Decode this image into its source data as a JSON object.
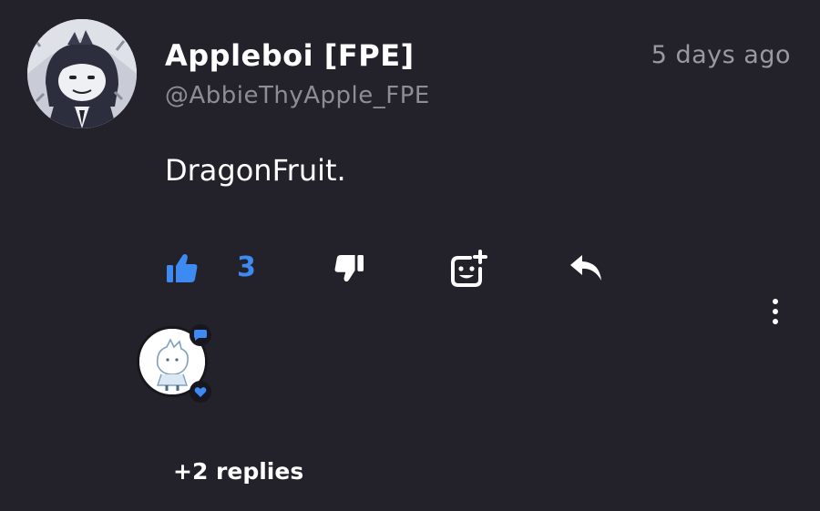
{
  "comment": {
    "author_name": "Appleboi [FPE]",
    "author_handle": "@AbbieThyApple_FPE",
    "timestamp": "5 days ago",
    "text": "DragonFruit."
  },
  "actions": {
    "like_icon": "thumbs-up-icon",
    "like_count": "3",
    "dislike_icon": "thumbs-down-icon",
    "react_icon": "add-reaction-icon",
    "reply_icon": "reply-arrow-icon",
    "more_icon": "more-vertical-icon"
  },
  "replies": {
    "label": "+2 replies",
    "badges": [
      "comment-bubble-icon",
      "heart-icon"
    ]
  },
  "colors": {
    "background": "#23222a",
    "accent": "#3d8bf2",
    "muted_text": "#8e8d96"
  }
}
